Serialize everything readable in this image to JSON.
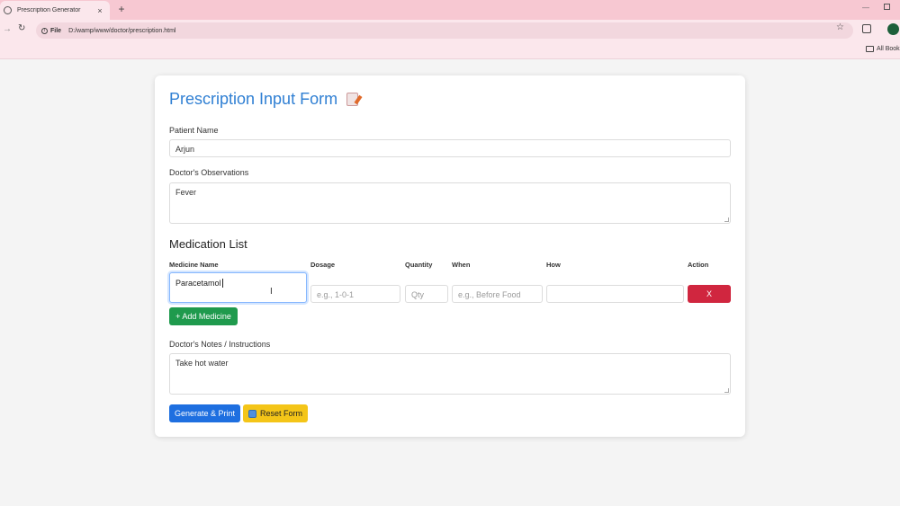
{
  "browser": {
    "tab_title": "Prescription Generator",
    "tab_close": "×",
    "new_tab": "+",
    "window_minimize": "—",
    "url_scheme": "File",
    "url": "D:/wamp/www/doctor/prescription.html",
    "bookmarks_label": "All Book"
  },
  "form": {
    "title": "Prescription Input Form",
    "patient_name_label": "Patient Name",
    "patient_name_value": "Arjun",
    "observations_label": "Doctor's Observations",
    "observations_value": "Fever",
    "medication_title": "Medication List",
    "columns": [
      "Medicine Name",
      "Dosage",
      "Quantity",
      "When",
      "How",
      "Action"
    ],
    "medicine_row": {
      "medicine_name": "Paracetamol",
      "dosage_placeholder": "e.g., 1-0-1",
      "quantity_placeholder": "Qty",
      "when_placeholder": "e.g., Before Food",
      "how_value": "",
      "remove_label": "X"
    },
    "add_medicine_label": "+ Add Medicine",
    "notes_label": "Doctor's Notes / Instructions",
    "notes_value": "Take hot water",
    "generate_label": "Generate & Print",
    "reset_label": "Reset Form"
  },
  "colors": {
    "title": "#2f7fd3",
    "remove_button": "#d0263f",
    "add_button": "#1f9a4d",
    "generate_button": "#1e6fe0",
    "reset_button": "#f4c518"
  },
  "icons": [
    "memo-icon",
    "reset-icon",
    "info-icon",
    "star-icon",
    "extensions-icon",
    "folder-icon"
  ]
}
